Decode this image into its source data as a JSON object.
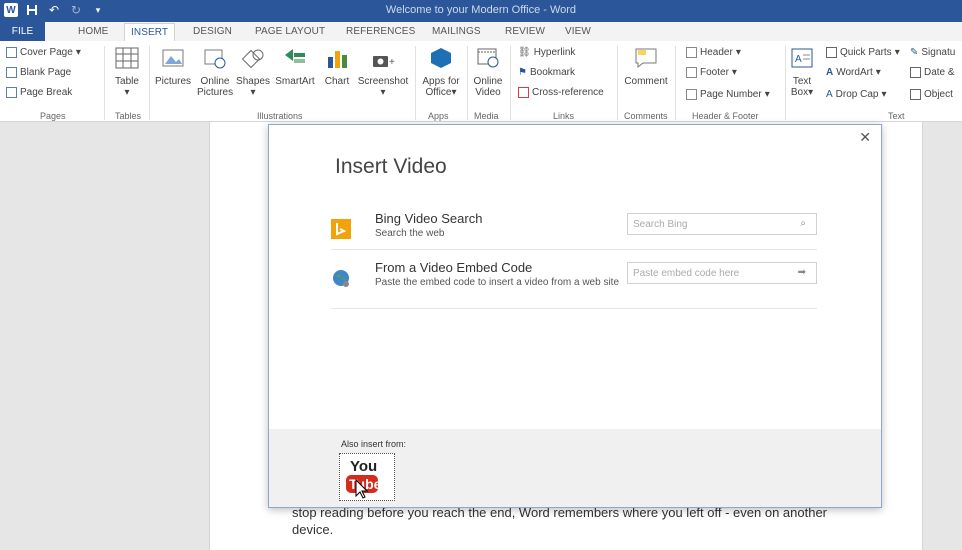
{
  "window": {
    "title": "Welcome to your Modern Office - Word"
  },
  "qat": {
    "save_icon": "save-icon",
    "undo_icon": "undo-icon",
    "redo_icon": "redo-icon"
  },
  "tabs": [
    {
      "label": "FILE"
    },
    {
      "label": "HOME"
    },
    {
      "label": "INSERT"
    },
    {
      "label": "DESIGN"
    },
    {
      "label": "PAGE LAYOUT"
    },
    {
      "label": "REFERENCES"
    },
    {
      "label": "MAILINGS"
    },
    {
      "label": "REVIEW"
    },
    {
      "label": "VIEW"
    }
  ],
  "ribbon": {
    "pages": {
      "cover_page": "Cover Page",
      "blank_page": "Blank Page",
      "page_break": "Page Break",
      "label": "Pages"
    },
    "tables": {
      "table": "Table",
      "label": "Tables"
    },
    "illustrations": {
      "pictures": "Pictures",
      "online_pictures_1": "Online",
      "online_pictures_2": "Pictures",
      "shapes": "Shapes",
      "smartart": "SmartArt",
      "chart": "Chart",
      "screenshot": "Screenshot",
      "label": "Illustrations"
    },
    "apps": {
      "apps_1": "Apps for",
      "apps_2": "Office",
      "label": "Apps"
    },
    "media": {
      "video_1": "Online",
      "video_2": "Video",
      "label": "Media"
    },
    "links": {
      "hyperlink": "Hyperlink",
      "bookmark": "Bookmark",
      "cross_reference": "Cross-reference",
      "label": "Links"
    },
    "comments": {
      "comment": "Comment",
      "label": "Comments"
    },
    "header_footer": {
      "header": "Header",
      "footer": "Footer",
      "page_number": "Page Number",
      "label": "Header & Footer"
    },
    "text": {
      "text_box_1": "Text",
      "text_box_2": "Box",
      "quick_parts": "Quick Parts",
      "wordart": "WordArt",
      "drop_cap": "Drop Cap",
      "signature": "Signatu",
      "date_time": "Date &",
      "object": "Object",
      "label": "Text"
    }
  },
  "dialog": {
    "title": "Insert Video",
    "options": [
      {
        "title": "Bing Video Search",
        "subtitle": "Search the web",
        "placeholder": "Search Bing",
        "icon": "bing-icon",
        "action_icon": "search-icon"
      },
      {
        "title": "From a Video Embed Code",
        "subtitle": "Paste the embed code to insert a video from a web site",
        "placeholder": "Paste embed code here",
        "icon": "globe-icon",
        "action_icon": "arrow-right-icon"
      }
    ],
    "also_insert": "Also insert from:",
    "youtube_icon": "youtube-icon"
  },
  "document": {
    "text": "stop reading before you reach the end, Word remembers where you left off - even on another device."
  }
}
